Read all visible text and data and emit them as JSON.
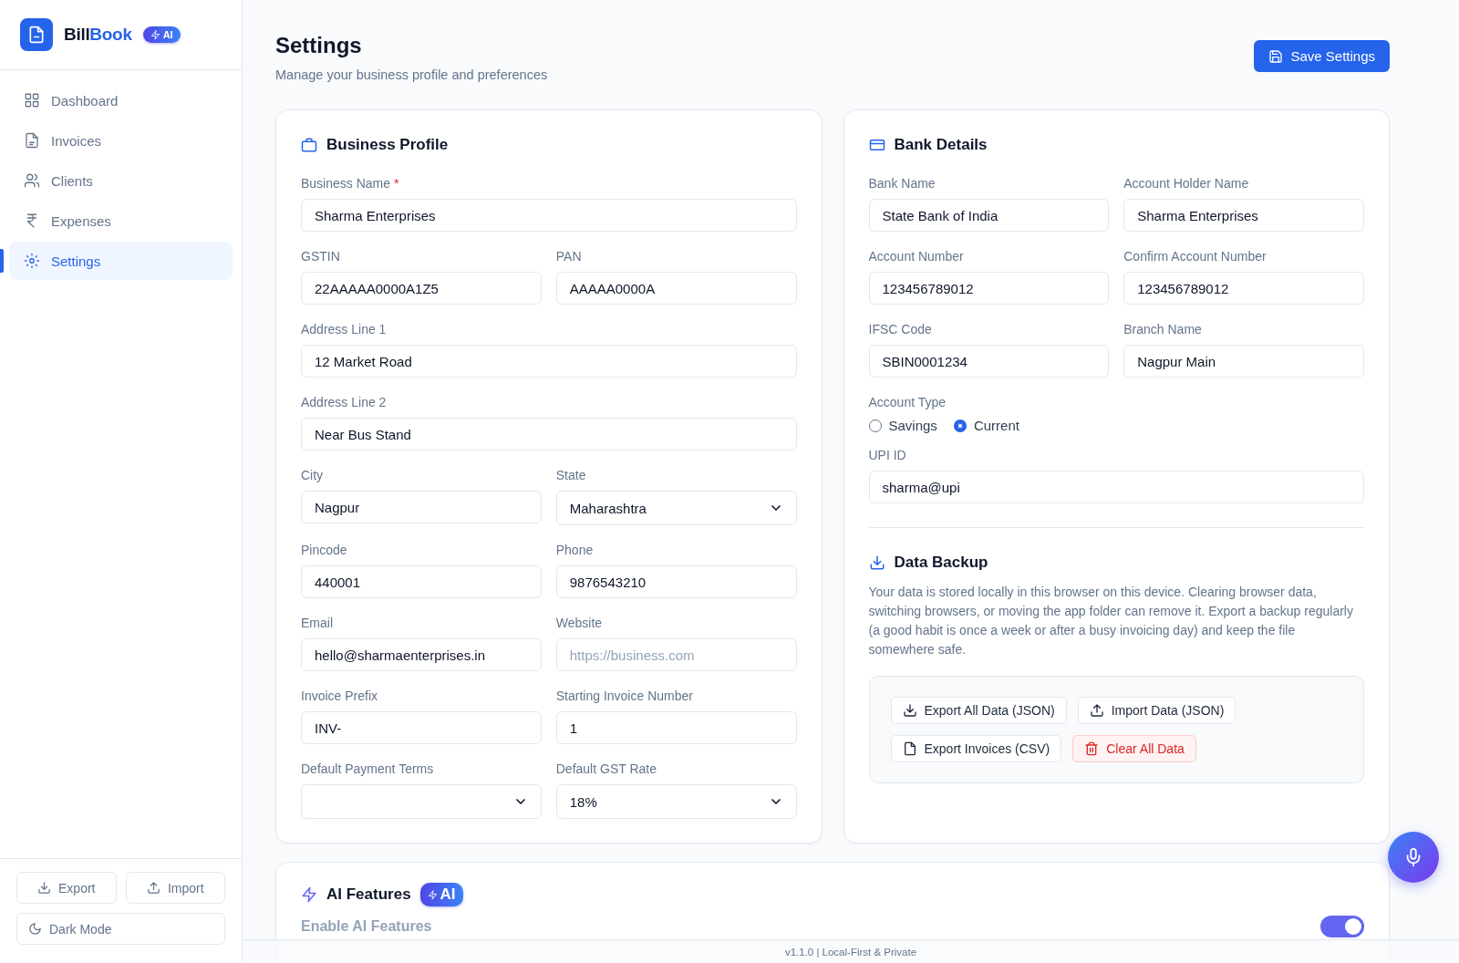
{
  "app": {
    "name_dark": "Bill",
    "name_accent": "Book",
    "badge": "AI"
  },
  "nav": [
    {
      "label": "Dashboard",
      "selected": false
    },
    {
      "label": "Invoices",
      "selected": false
    },
    {
      "label": "Clients",
      "selected": false
    },
    {
      "label": "Expenses",
      "selected": false
    },
    {
      "label": "Settings",
      "selected": true
    }
  ],
  "sidebar_footer": {
    "buttons": [
      {
        "label": "Export"
      },
      {
        "label": "Import"
      }
    ],
    "dark_mode": "Dark Mode"
  },
  "header": {
    "title": "Settings",
    "subtitle": "Manage your business profile and preferences",
    "save_button": "Save Settings"
  },
  "business_profile": {
    "title": "Business Profile",
    "rows": [
      [
        {
          "label": "Business Name",
          "required_mark": "*",
          "kind": "text",
          "value": "Sharma Enterprises"
        }
      ],
      [
        {
          "label": "GSTIN",
          "kind": "text",
          "value": "22AAAAA0000A1Z5"
        },
        {
          "label": "PAN",
          "kind": "text",
          "value": "AAAAA0000A"
        }
      ],
      [
        {
          "label": "Address Line 1",
          "kind": "text",
          "value": "12 Market Road"
        }
      ],
      [
        {
          "label": "Address Line 2",
          "kind": "text",
          "value": "Near Bus Stand"
        }
      ],
      [
        {
          "label": "City",
          "kind": "text",
          "value": "Nagpur"
        },
        {
          "label": "State",
          "kind": "select",
          "value": "Maharashtra"
        }
      ],
      [
        {
          "label": "Pincode",
          "kind": "text",
          "value": "440001"
        },
        {
          "label": "Phone",
          "kind": "text",
          "value": "9876543210"
        }
      ],
      [
        {
          "label": "Email",
          "kind": "text",
          "value": "hello@sharmaenterprises.in"
        },
        {
          "label": "Website",
          "kind": "text",
          "placeholder": "https://business.com"
        }
      ],
      [
        {
          "label": "Invoice Prefix",
          "kind": "text",
          "value": "INV-"
        },
        {
          "label": "Starting Invoice Number",
          "kind": "text",
          "value": "1"
        }
      ],
      [
        {
          "label": "Default Payment Terms",
          "kind": "select"
        },
        {
          "label": "Default GST Rate",
          "kind": "select",
          "value": "18%"
        }
      ]
    ]
  },
  "bank_details": {
    "title": "Bank Details",
    "rows": [
      [
        {
          "label": "Bank Name",
          "kind": "text",
          "value": "State Bank of India"
        },
        {
          "label": "Account Holder Name",
          "kind": "text",
          "value": "Sharma Enterprises"
        }
      ],
      [
        {
          "label": "Account Number",
          "kind": "text",
          "value": "123456789012"
        },
        {
          "label": "Confirm Account Number",
          "kind": "text",
          "value": "123456789012"
        }
      ],
      [
        {
          "label": "IFSC Code",
          "kind": "text",
          "value": "SBIN0001234"
        },
        {
          "label": "Branch Name",
          "kind": "text",
          "value": "Nagpur Main"
        }
      ]
    ],
    "account_type": {
      "label": "Account Type",
      "options": [
        {
          "label": "Savings",
          "selected": false
        },
        {
          "label": "Current",
          "selected": true
        }
      ]
    },
    "upi": {
      "label": "UPI ID",
      "value": "sharma@upi"
    }
  },
  "data_backup": {
    "title": "Data Backup",
    "description": "Your data is stored locally in this browser on this device. Clearing browser data, switching browsers, or moving the app folder can remove it. Export a backup regularly (a good habit is once a week or after a busy invoicing day) and keep the file somewhere safe.",
    "buttons": [
      {
        "label": "Export All Data (JSON)",
        "kind": "normal"
      },
      {
        "label": "Import Data (JSON)",
        "kind": "normal"
      },
      {
        "label": "Export Invoices (CSV)",
        "kind": "normal"
      },
      {
        "label": "Clear All Data",
        "kind": "danger"
      }
    ]
  },
  "ai_features": {
    "title": "AI Features",
    "badge": "AI",
    "setting": {
      "label": "Enable AI Features",
      "on": true
    }
  },
  "footer": {
    "version": "v1.1.0 | Local-First & Private"
  }
}
